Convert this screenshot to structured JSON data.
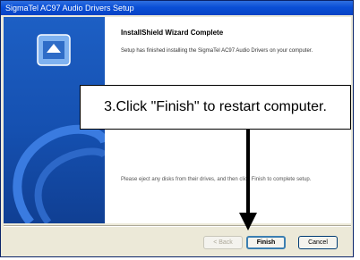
{
  "window": {
    "title": "SigmaTel AC97 Audio Drivers Setup"
  },
  "wizard": {
    "heading": "InstallShield Wizard Complete",
    "description": "Setup has finished installing the SigmaTel AC97 Audio Drivers on your computer.",
    "footer_note": "Please eject any disks from their drives, and then click Finish to complete setup."
  },
  "buttons": {
    "back": "< Back",
    "finish": "Finish",
    "cancel": "Cancel"
  },
  "callout": {
    "text": "3.Click \"Finish\" to restart computer."
  },
  "colors": {
    "titlebar": "#0a4fd6",
    "banner": "#1550b0",
    "dialog": "#ece9d8"
  }
}
